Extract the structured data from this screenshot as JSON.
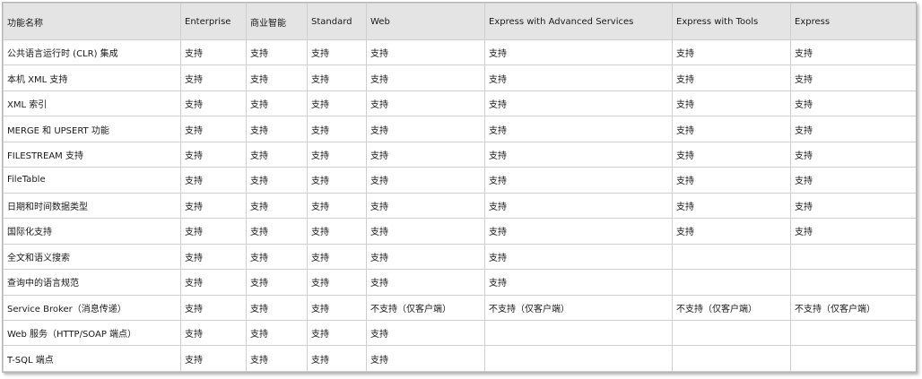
{
  "table": {
    "headers": [
      "功能名称",
      "Enterprise",
      "商业智能",
      "Standard",
      "Web",
      "Express with Advanced Services",
      "Express with Tools",
      "Express"
    ],
    "rows": [
      [
        "公共语言运行时 (CLR) 集成",
        "支持",
        "支持",
        "支持",
        "支持",
        "支持",
        "支持",
        "支持"
      ],
      [
        "本机 XML 支持",
        "支持",
        "支持",
        "支持",
        "支持",
        "支持",
        "支持",
        "支持"
      ],
      [
        "XML 索引",
        "支持",
        "支持",
        "支持",
        "支持",
        "支持",
        "支持",
        "支持"
      ],
      [
        "MERGE 和 UPSERT 功能",
        "支持",
        "支持",
        "支持",
        "支持",
        "支持",
        "支持",
        "支持"
      ],
      [
        "FILESTREAM 支持",
        "支持",
        "支持",
        "支持",
        "支持",
        "支持",
        "支持",
        "支持"
      ],
      [
        "FileTable",
        "支持",
        "支持",
        "支持",
        "支持",
        "支持",
        "支持",
        "支持"
      ],
      [
        "日期和时间数据类型",
        "支持",
        "支持",
        "支持",
        "支持",
        "支持",
        "支持",
        "支持"
      ],
      [
        "国际化支持",
        "支持",
        "支持",
        "支持",
        "支持",
        "支持",
        "支持",
        "支持"
      ],
      [
        "全文和语义搜索",
        "支持",
        "支持",
        "支持",
        "支持",
        "支持",
        "",
        ""
      ],
      [
        "查询中的语言规范",
        "支持",
        "支持",
        "支持",
        "支持",
        "支持",
        "",
        ""
      ],
      [
        "Service Broker（消息传递）",
        "支持",
        "支持",
        "支持",
        "不支持（仅客户端）",
        "不支持（仅客户端）",
        "不支持（仅客户端）",
        "不支持（仅客户端）"
      ],
      [
        "Web 服务（HTTP/SOAP 端点）",
        "支持",
        "支持",
        "支持",
        "支持",
        "",
        "",
        ""
      ],
      [
        "T-SQL 端点",
        "支持",
        "支持",
        "支持",
        "支持",
        "",
        "",
        ""
      ]
    ]
  }
}
